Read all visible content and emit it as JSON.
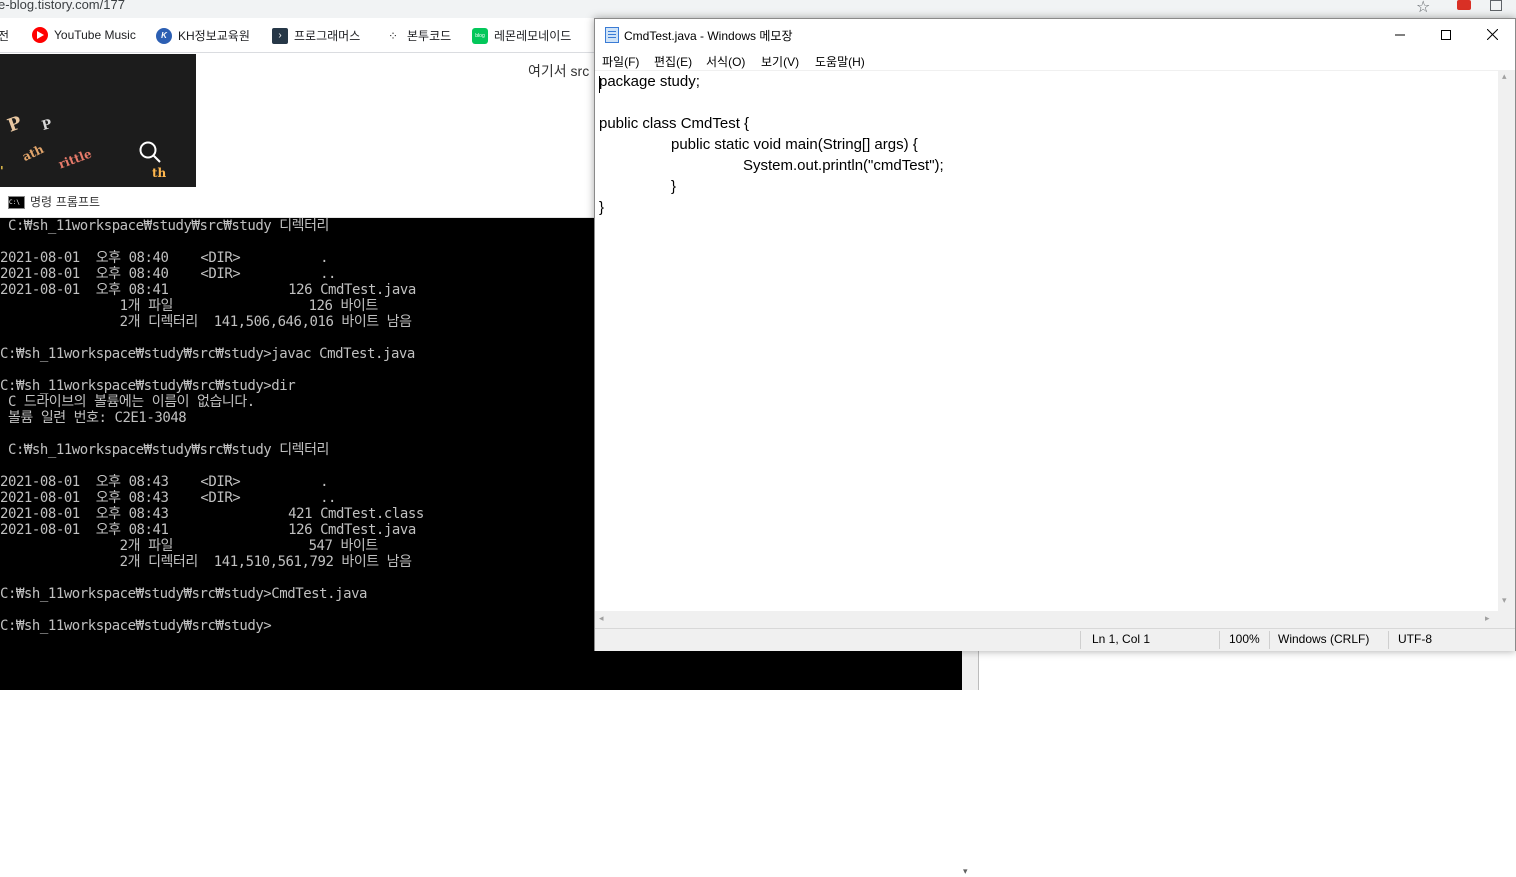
{
  "browser": {
    "url": "e-blog.tistory.com/177",
    "bookmarks": [
      {
        "label": "전"
      },
      {
        "label": "YouTube Music",
        "color": "#ff0000"
      },
      {
        "label": "KH정보교육원",
        "color": "#2c5fb3"
      },
      {
        "label": "프로그래머스",
        "color": "#263747"
      },
      {
        "label": "본투코드",
        "color": "#333333"
      },
      {
        "label": "레몬레모네이드",
        "color": "#03c75a"
      }
    ],
    "page_text": "여기서 src"
  },
  "cmd": {
    "title": "명령 프롬프트",
    "lines": [
      " C:₩sh_11workspace₩study₩src₩study 디렉터리",
      "",
      "2021-08-01  오후 08:40    <DIR>          .",
      "2021-08-01  오후 08:40    <DIR>          ..",
      "2021-08-01  오후 08:41               126 CmdTest.java",
      "               1개 파일                 126 바이트",
      "               2개 디렉터리  141,506,646,016 바이트 남음",
      "",
      "C:₩sh_11workspace₩study₩src₩study>javac CmdTest.java",
      "",
      "C:₩sh_11workspace₩study₩src₩study>dir",
      " C 드라이브의 볼륨에는 이름이 없습니다.",
      " 볼륨 일련 번호: C2E1-3048",
      "",
      " C:₩sh_11workspace₩study₩src₩study 디렉터리",
      "",
      "2021-08-01  오후 08:43    <DIR>          .",
      "2021-08-01  오후 08:43    <DIR>          ..",
      "2021-08-01  오후 08:43               421 CmdTest.class",
      "2021-08-01  오후 08:41               126 CmdTest.java",
      "               2개 파일                 547 바이트",
      "               2개 디렉터리  141,510,561,792 바이트 남음",
      "",
      "C:₩sh_11workspace₩study₩src₩study>CmdTest.java",
      "",
      "C:₩sh_11workspace₩study₩src₩study>"
    ]
  },
  "notepad": {
    "title": "CmdTest.java - Windows 메모장",
    "menu": [
      "파일(F)",
      "편집(E)",
      "서식(O)",
      "보기(V)",
      "도움말(H)"
    ],
    "code_lines": [
      "package study;",
      "",
      "public class CmdTest {",
      "\tpublic static void main(String[] args) {",
      "\t\tSystem.out.println(\"cmdTest\");",
      "\t}",
      "}"
    ],
    "status": {
      "position": "Ln 1, Col 1",
      "zoom": "100%",
      "line_ending": "Windows (CRLF)",
      "encoding": "UTF-8"
    }
  }
}
